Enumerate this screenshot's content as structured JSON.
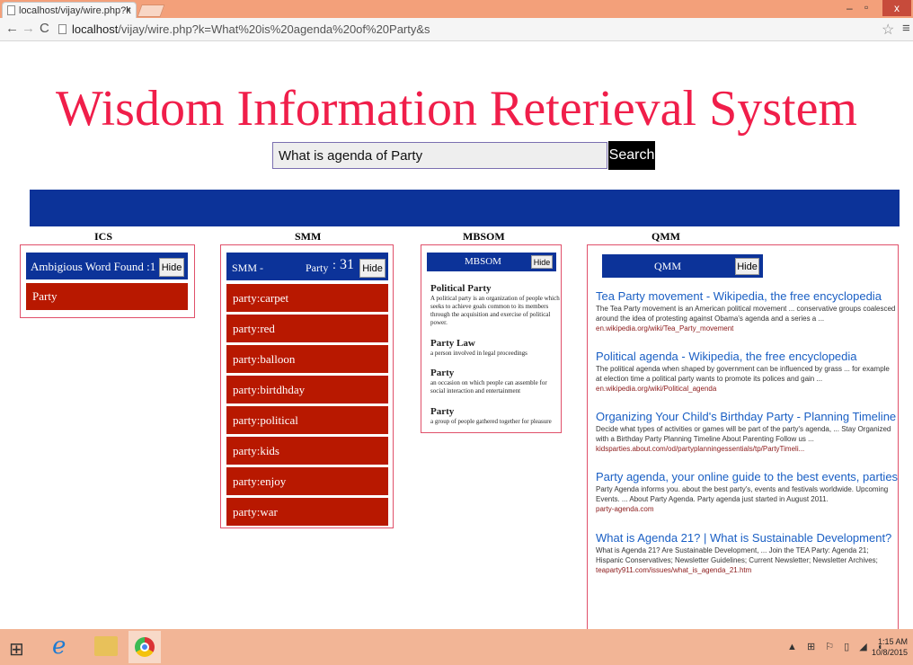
{
  "browser": {
    "tab_title": "localhost/vijay/wire.php?k",
    "tab_close": "×",
    "url_host": "localhost",
    "url_rest": "/vijay/wire.php?k=What%20is%20agenda%20of%20Party&s",
    "icons": [
      "page-icon",
      "back-icon",
      "forward-icon",
      "reload-icon",
      "star-icon",
      "menu-icon"
    ]
  },
  "window": {
    "minimize": "–",
    "maximize": "▫",
    "close": "x"
  },
  "page": {
    "title": "Wisdom Information Reterieval System",
    "search": {
      "value": "What is agenda of Party",
      "button": "Search"
    },
    "colors": {
      "title": "#f01e4a",
      "band": "#0c3399",
      "item": "#b81800",
      "panel_border": "#e0506a"
    }
  },
  "ics": {
    "label": "ICS",
    "header": "Ambigious Word Found :1",
    "hide": "Hide",
    "items": [
      "Party"
    ]
  },
  "smm": {
    "label": "SMM",
    "header_left": "SMM -",
    "header_word": "Party",
    "header_sep": ":",
    "header_count": "31",
    "hide": "Hide",
    "items": [
      "party:carpet",
      "party:red",
      "party:balloon",
      "party:birtdhday",
      "party:political",
      "party:kids",
      "party:enjoy",
      "party:war"
    ]
  },
  "mbsom": {
    "label": "MBSOM",
    "header": "MBSOM",
    "hide": "Hide",
    "definitions": [
      {
        "term": "Political Party",
        "text": "A political party is an organization of people which seeks to achieve goals common to its members through the acquisition and exercise of political power."
      },
      {
        "term": "Party Law",
        "text": "a person involved in legal proceedings"
      },
      {
        "term": "Party",
        "text": "an occasion on which people can assemble for social interaction and entertainment"
      },
      {
        "term": "Party",
        "text": "a group of people gathered together for pleasure"
      }
    ]
  },
  "qmm": {
    "label": "QMM",
    "header": "QMM",
    "hide": "Hide",
    "results": [
      {
        "title": "Tea Party movement - Wikipedia, the free encyclopedia",
        "snippet": "The Tea Party movement is an American political movement ... conservative groups coalesced around the idea of protesting against Obama's agenda and a series a ...",
        "url": "en.wikipedia.org/wiki/Tea_Party_movement"
      },
      {
        "title": "Political agenda - Wikipedia, the free encyclopedia",
        "snippet": "The political agenda when shaped by government can be influenced by grass ... for example at election time a political party wants to promote its polices and gain ...",
        "url": "en.wikipedia.org/wiki/Political_agenda"
      },
      {
        "title": "Organizing Your Child's Birthday Party - Planning Timeline",
        "snippet": "Decide what types of activities or games will be part of the party's agenda, ... Stay Organized with a Birthday Party Planning Timeline About Parenting Follow us ...",
        "url": "kidsparties.about.com/od/partyplanningessentials/tp/PartyTimeli..."
      },
      {
        "title": "Party agenda, your online guide to the best events, parties ...",
        "snippet": "Party Agenda informs you. about the best party's, events and festivals worldwide. Upcoming Events. ... About Party Agenda. Party agenda just started in August 2011.",
        "url": "party-agenda.com"
      },
      {
        "title": "What is Agenda 21? | What is Sustainable Development?",
        "snippet": "What is Agenda 21? Are Sustainable Development, ... Join the TEA Party: Agenda 21; Hispanic Conservatives; Newsletter Guidelines; Current Newsletter; Newsletter Archives;",
        "url": "teaparty911.com/issues/what_is_agenda_21.htm"
      }
    ]
  },
  "taskbar": {
    "icons": [
      "windows-start-icon",
      "internet-explorer-icon",
      "file-explorer-icon",
      "chrome-icon"
    ],
    "tray": "▲ ⊞ ⚐ ▯ ◢ ◖",
    "time": "1:15 AM",
    "date": "10/8/2015"
  }
}
